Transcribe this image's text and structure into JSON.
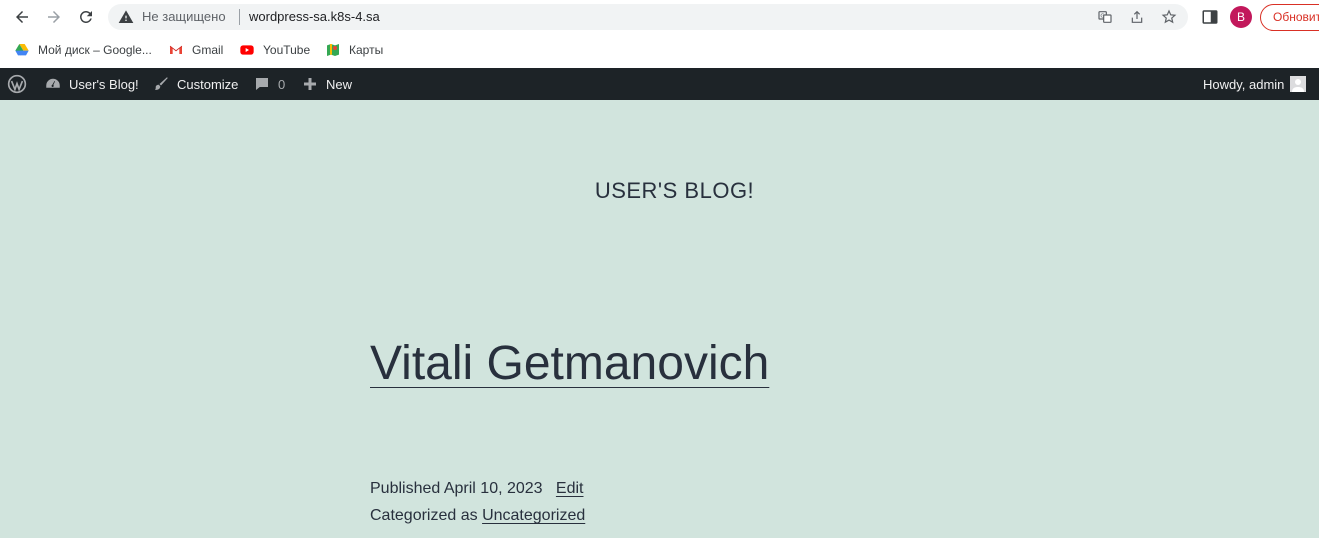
{
  "browser": {
    "omnibox": {
      "security_label": "Не защищено",
      "url": "wordpress-sa.k8s-4.sa"
    },
    "profile_initial": "B",
    "update_label": "Обновить",
    "bookmarks": [
      {
        "label": "Мой диск – Google...",
        "icon": "google-drive-icon"
      },
      {
        "label": "Gmail",
        "icon": "gmail-icon"
      },
      {
        "label": "YouTube",
        "icon": "youtube-icon"
      },
      {
        "label": "Карты",
        "icon": "maps-icon"
      }
    ]
  },
  "adminbar": {
    "site_name": "User's Blog!",
    "customize": "Customize",
    "comments_count": "0",
    "new": "New",
    "howdy": "Howdy, admin"
  },
  "site": {
    "title": "USER'S BLOG!"
  },
  "post": {
    "title": "Vitali Getmanovich",
    "published_label": "Published April 10, 2023",
    "edit_label": "Edit",
    "categorized_label": "Categorized as",
    "category": "Uncategorized"
  },
  "colors": {
    "page_bg": "#d1e4dd",
    "adminbar_bg": "#1d2327",
    "text": "#28303d",
    "update_red": "#d93025",
    "avatar": "#c2185b"
  }
}
